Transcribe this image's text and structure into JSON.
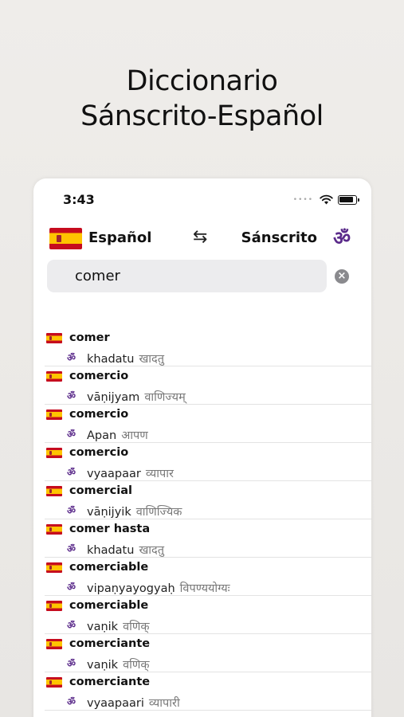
{
  "headline": {
    "line1": "Diccionario",
    "line2": "Sánscrito-Español"
  },
  "status_bar": {
    "time": "3:43",
    "icons": [
      "signal-dots-icon",
      "wifi-icon",
      "battery-icon"
    ]
  },
  "language_bar": {
    "source_language": "Español",
    "target_language": "Sánscrito",
    "swap_icon": "⇆",
    "target_icon": "ॐ",
    "colors": {
      "om": "#5a2a8a",
      "flag_red": "#c60b1e",
      "flag_yellow": "#ffc400"
    }
  },
  "search": {
    "value": "comer",
    "clear_icon": "×"
  },
  "results": [
    {
      "word": "comer",
      "translit": "khadatu",
      "devanagari": "खादतु"
    },
    {
      "word": "comercio",
      "translit": "vāṇijyam",
      "devanagari": "वाणिज्यम्"
    },
    {
      "word": "comercio",
      "translit": "Apan",
      "devanagari": "आपण"
    },
    {
      "word": "comercio",
      "translit": "vyaapaar",
      "devanagari": "व्यापार"
    },
    {
      "word": "comercial",
      "translit": "vāṇijyik",
      "devanagari": "वाणिज्यिक"
    },
    {
      "word": "comer hasta",
      "translit": "khadatu",
      "devanagari": "खादतु"
    },
    {
      "word": "comerciable",
      "translit": "vipaṇyayogyaḥ",
      "devanagari": "विपण्ययोग्यः"
    },
    {
      "word": "comerciable",
      "translit": "vaṇik",
      "devanagari": "वणिक्"
    },
    {
      "word": "comerciante",
      "translit": "vaṇik",
      "devanagari": "वणिक्"
    },
    {
      "word": "comerciante",
      "translit": "vyaapaari",
      "devanagari": "व्यापारी"
    }
  ],
  "result_om": "ॐ"
}
